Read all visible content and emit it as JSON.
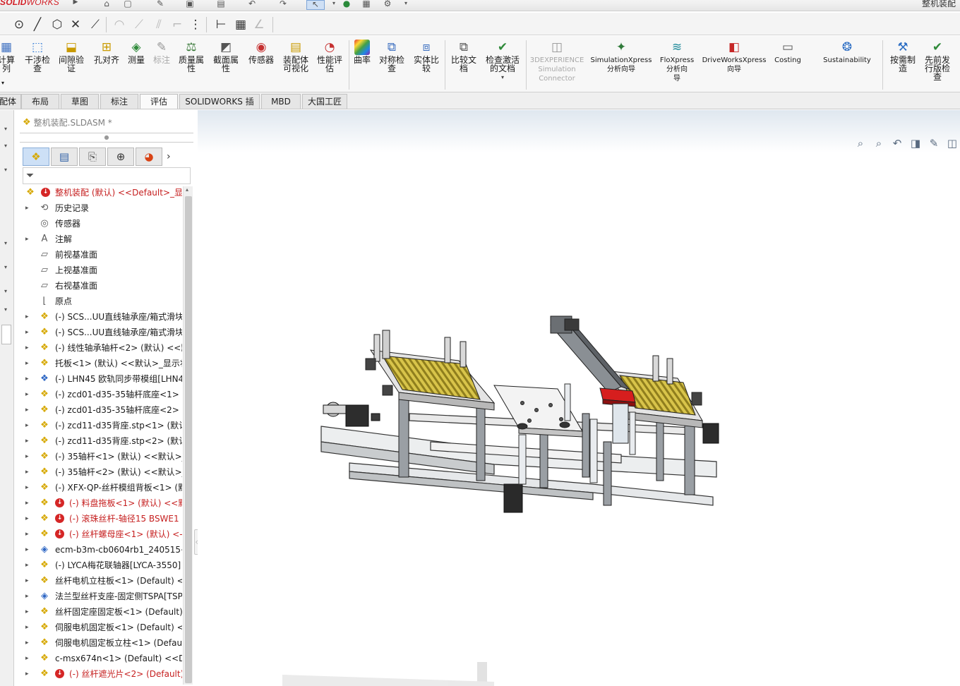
{
  "app": {
    "brand_bold": "SOLID",
    "brand_thin": "WORKS",
    "window_title": "整机装配"
  },
  "ribbon": [
    {
      "label": "干涉检\n查",
      "icon": "interference-check-icon"
    },
    {
      "label": "间隙验\n证",
      "icon": "clearance-verification-icon"
    },
    {
      "label": "孔对齐",
      "icon": "hole-alignment-icon"
    },
    {
      "label": "测量",
      "icon": "measure-icon"
    },
    {
      "label": "标注",
      "icon": "markup-icon"
    },
    {
      "label": "质量属\n性",
      "icon": "mass-properties-icon"
    },
    {
      "label": "截面属\n性",
      "icon": "section-properties-icon"
    },
    {
      "label": "传感器",
      "icon": "sensor-icon"
    },
    {
      "label": "装配体\n可视化",
      "icon": "assembly-visualization-icon"
    },
    {
      "label": "性能评\n估",
      "icon": "performance-evaluation-icon"
    },
    {
      "label": "曲率",
      "icon": "curvature-icon"
    },
    {
      "label": "对称检\n查",
      "icon": "symmetry-check-icon"
    },
    {
      "label": "实体比\n较",
      "icon": "compare-bodies-icon"
    },
    {
      "label": "比较文\n档",
      "icon": "compare-documents-icon"
    },
    {
      "label": "检查激活\n的文档",
      "icon": "check-active-document-icon"
    },
    {
      "label": "3DEXPERIENCE\nSimulation\nConnector",
      "icon": "3dexperience-icon"
    },
    {
      "label": "SimulationXpress\n分析向导",
      "icon": "simulationxpress-icon"
    },
    {
      "label": "FloXpress\n分析向\n导",
      "icon": "floxpress-icon"
    },
    {
      "label": "DriveWorksXpress\n向导",
      "icon": "driveworksxpress-icon"
    },
    {
      "label": "Costing",
      "icon": "costing-icon"
    },
    {
      "label": "Sustainability",
      "icon": "sustainability-icon"
    },
    {
      "label": "按需制\n造",
      "icon": "manufacture-on-demand-icon"
    },
    {
      "label": "先前发\n行版检\n查",
      "icon": "previous-release-check-icon"
    }
  ],
  "ribbon_left_partial": "计算\n列",
  "tabs": [
    {
      "label": "配体"
    },
    {
      "label": "布局"
    },
    {
      "label": "草图"
    },
    {
      "label": "标注"
    },
    {
      "label": "评估"
    },
    {
      "label": "SOLIDWORKS 插件"
    },
    {
      "label": "MBD"
    },
    {
      "label": "大国工匠"
    }
  ],
  "feature_manager": {
    "document_name": "整机装配.SLDASM *",
    "tree": [
      {
        "text": "整机装配 (默认) <<Default>_显示",
        "icon": "assembly-icon",
        "expander": "",
        "error": true,
        "red": true,
        "indent": 0
      },
      {
        "text": "历史记录",
        "icon": "history-icon",
        "expander": "▸",
        "error": false,
        "red": false,
        "indent": 1
      },
      {
        "text": "传感器",
        "icon": "sensor-folder-icon",
        "expander": "",
        "error": false,
        "red": false,
        "indent": 1
      },
      {
        "text": "注解",
        "icon": "annotations-icon",
        "expander": "▸",
        "error": false,
        "red": false,
        "indent": 1
      },
      {
        "text": "前视基准面",
        "icon": "plane-icon",
        "expander": "",
        "error": false,
        "red": false,
        "indent": 1
      },
      {
        "text": "上视基准面",
        "icon": "plane-icon",
        "expander": "",
        "error": false,
        "red": false,
        "indent": 1
      },
      {
        "text": "右视基准面",
        "icon": "plane-icon",
        "expander": "",
        "error": false,
        "red": false,
        "indent": 1
      },
      {
        "text": "原点",
        "icon": "origin-icon",
        "expander": "",
        "error": false,
        "red": false,
        "indent": 1
      },
      {
        "text": "(-) SCS...UU直线轴承座/箱式滑块",
        "icon": "subassembly-icon",
        "expander": "▸",
        "error": false,
        "red": false,
        "indent": 1
      },
      {
        "text": "(-) SCS...UU直线轴承座/箱式滑块",
        "icon": "subassembly-icon",
        "expander": "▸",
        "error": false,
        "red": false,
        "indent": 1
      },
      {
        "text": "(-) 线性轴承轴杆<2> (默认) <<默",
        "icon": "subassembly-icon",
        "expander": "▸",
        "error": false,
        "red": false,
        "indent": 1
      },
      {
        "text": "托板<1> (默认) <<默认>_显示状",
        "icon": "subassembly-icon",
        "expander": "▸",
        "error": false,
        "red": false,
        "indent": 1
      },
      {
        "text": "(-) LHN45 欧轨同步带模组[LHN4",
        "icon": "rigid-subassembly-icon",
        "expander": "▸",
        "error": false,
        "red": false,
        "indent": 1
      },
      {
        "text": "(-) zcd01-d35-35轴杆底座<1> (",
        "icon": "subassembly-icon",
        "expander": "▸",
        "error": false,
        "red": false,
        "indent": 1
      },
      {
        "text": "(-) zcd01-d35-35轴杆底座<2> (",
        "icon": "subassembly-icon",
        "expander": "▸",
        "error": false,
        "red": false,
        "indent": 1
      },
      {
        "text": "(-) zcd11-d35背座.stp<1> (默认",
        "icon": "imported-icon",
        "expander": "▸",
        "error": false,
        "red": false,
        "indent": 1
      },
      {
        "text": "(-) zcd11-d35背座.stp<2> (默认",
        "icon": "imported-icon",
        "expander": "▸",
        "error": false,
        "red": false,
        "indent": 1
      },
      {
        "text": "(-) 35轴杆<1> (默认) <<默认>_",
        "icon": "subassembly-icon",
        "expander": "▸",
        "error": false,
        "red": false,
        "indent": 1
      },
      {
        "text": "(-) 35轴杆<2> (默认) <<默认>_",
        "icon": "subassembly-icon",
        "expander": "▸",
        "error": false,
        "red": false,
        "indent": 1
      },
      {
        "text": "(-) XFX-QP-丝杆模组背板<1> (默",
        "icon": "subassembly-icon",
        "expander": "▸",
        "error": false,
        "red": false,
        "indent": 1
      },
      {
        "text": "(-) 料盘拖板<1> (默认) <<默",
        "icon": "subassembly-icon",
        "expander": "▸",
        "error": true,
        "red": true,
        "indent": 1
      },
      {
        "text": "(-) 滚珠丝杆-轴径15 BSWE1",
        "icon": "flexible-subassembly-icon",
        "expander": "▸",
        "error": true,
        "red": true,
        "indent": 1
      },
      {
        "text": "(-) 丝杆螺母座<1> (默认) <-",
        "icon": "subassembly-icon",
        "expander": "▸",
        "error": true,
        "red": true,
        "indent": 1
      },
      {
        "text": "ecm-b3m-cb0604rb1_240515<",
        "icon": "part-icon",
        "expander": "▸",
        "error": false,
        "red": false,
        "indent": 1
      },
      {
        "text": "(-) LYCA梅花联轴器[LYCA-3550]",
        "icon": "subassembly-icon",
        "expander": "▸",
        "error": false,
        "red": false,
        "indent": 1
      },
      {
        "text": "丝杆电机立柱板<1> (Default) <-",
        "icon": "subassembly-icon",
        "expander": "▸",
        "error": false,
        "red": false,
        "indent": 1
      },
      {
        "text": "法兰型丝杆支座-固定侧TSPA[TSP",
        "icon": "part-icon",
        "expander": "▸",
        "error": false,
        "red": false,
        "indent": 1
      },
      {
        "text": "丝杆固定座固定板<1> (Default)",
        "icon": "subassembly-icon",
        "expander": "▸",
        "error": false,
        "red": false,
        "indent": 1
      },
      {
        "text": "伺服电机固定板<1> (Default) <-",
        "icon": "subassembly-icon",
        "expander": "▸",
        "error": false,
        "red": false,
        "indent": 1
      },
      {
        "text": "伺服电机固定板立柱<1> (Defaul",
        "icon": "subassembly-icon",
        "expander": "▸",
        "error": false,
        "red": false,
        "indent": 1
      },
      {
        "text": "c-msx674n<1> (Default) <<De",
        "icon": "subassembly-icon",
        "expander": "▸",
        "error": false,
        "red": false,
        "indent": 1
      },
      {
        "text": "(-) 丝杆遮光片<2> (Default)",
        "icon": "subassembly-icon",
        "expander": "▸",
        "error": true,
        "red": true,
        "indent": 1
      }
    ]
  },
  "colors": {
    "brand": "#d21f26",
    "error": "#d52626",
    "error_text": "#c62020",
    "assembly_icon": "#d6a800",
    "selected_tab_bg": "#cde0f6"
  }
}
